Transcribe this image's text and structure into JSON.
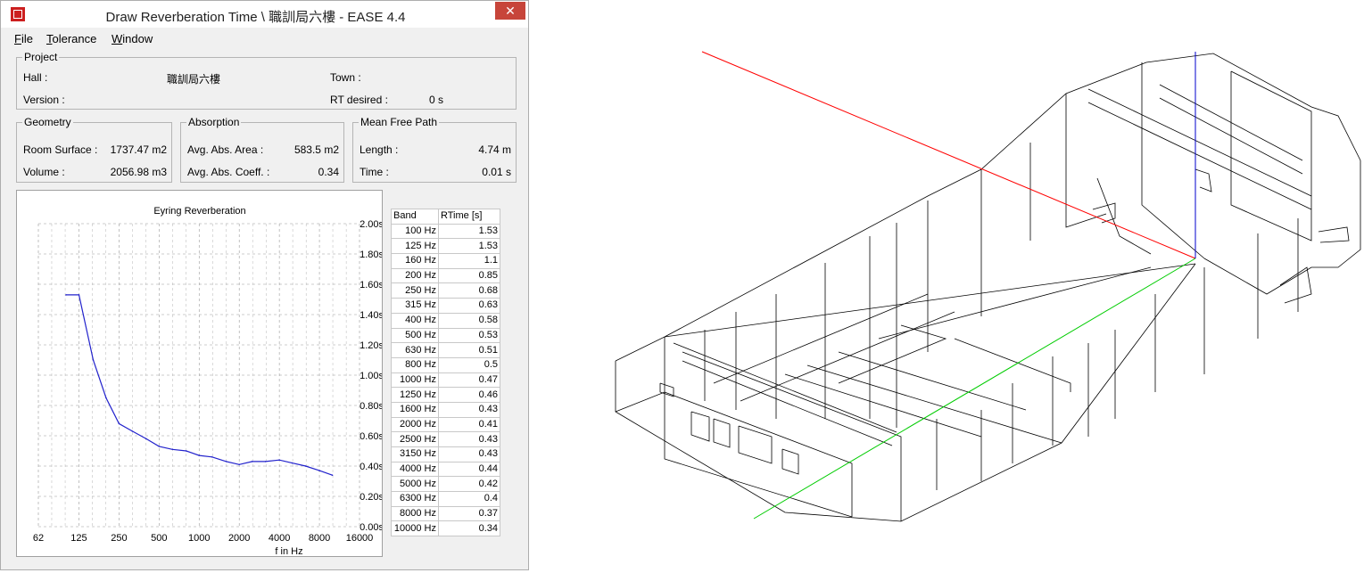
{
  "window": {
    "title": "Draw Reverberation Time \\ 職訓局六樓 - EASE 4.4",
    "close_glyph": "✕"
  },
  "menu": {
    "file": {
      "u": "F",
      "rest": "ile"
    },
    "tolerance": {
      "u": "T",
      "rest": "olerance"
    },
    "window": {
      "u": "W",
      "rest": "indow"
    }
  },
  "project": {
    "legend": "Project",
    "hall_label": "Hall :",
    "hall_value": "職訓局六樓",
    "version_label": "Version :",
    "town_label": "Town :",
    "rt_label": "RT desired :",
    "rt_value": "0 s"
  },
  "geometry": {
    "legend": "Geometry",
    "surface_label": "Room Surface :",
    "surface_value": "1737.47 m2",
    "volume_label": "Volume :",
    "volume_value": "2056.98 m3"
  },
  "absorption": {
    "legend": "Absorption",
    "area_label": "Avg. Abs. Area :",
    "area_value": "583.5 m2",
    "coeff_label": "Avg. Abs. Coeff. :",
    "coeff_value": "0.34"
  },
  "mfp": {
    "legend": "Mean Free Path",
    "length_label": "Length :",
    "length_value": "4.74 m",
    "time_label": "Time :",
    "time_value": "0.01 s"
  },
  "table": {
    "header_band": "Band",
    "header_rt": "RTime [s]"
  },
  "colors": {
    "curve": "#2222cc",
    "axis_x": "#ff0000",
    "axis_y": "#00cc00",
    "axis_z": "#0000cc"
  },
  "chart_data": {
    "type": "line",
    "title": "Eyring Reverberation",
    "xlabel": "f in Hz",
    "ylabel": "",
    "x_scale": "log",
    "x_tick_labels": [
      "62",
      "125",
      "250",
      "500",
      "1000",
      "2000",
      "4000",
      "8000",
      "16000"
    ],
    "x_ticks": [
      62,
      125,
      250,
      500,
      1000,
      2000,
      4000,
      8000,
      16000
    ],
    "y_tick_labels": [
      "0.00s",
      "0.20s",
      "0.40s",
      "0.60s",
      "0.80s",
      "1.00s",
      "1.20s",
      "1.40s",
      "1.60s",
      "1.80s",
      "2.00s"
    ],
    "ylim": [
      0,
      2.0
    ],
    "xlim": [
      62,
      16000
    ],
    "grid": true,
    "series": [
      {
        "x": [
          100,
          125,
          160,
          200,
          250,
          315,
          400,
          500,
          630,
          800,
          1000,
          1250,
          1600,
          2000,
          2500,
          3150,
          4000,
          5000,
          6300,
          8000,
          10000
        ],
        "bands": [
          "100 Hz",
          "125 Hz",
          "160 Hz",
          "200 Hz",
          "250 Hz",
          "315 Hz",
          "400 Hz",
          "500 Hz",
          "630 Hz",
          "800 Hz",
          "1000 Hz",
          "1250 Hz",
          "1600 Hz",
          "2000 Hz",
          "2500 Hz",
          "3150 Hz",
          "4000 Hz",
          "5000 Hz",
          "6300 Hz",
          "8000 Hz",
          "10000 Hz"
        ],
        "values": [
          1.53,
          1.53,
          1.1,
          0.85,
          0.68,
          0.63,
          0.58,
          0.53,
          0.51,
          0.5,
          0.47,
          0.46,
          0.43,
          0.41,
          0.43,
          0.43,
          0.44,
          0.42,
          0.4,
          0.37,
          0.34
        ]
      }
    ]
  }
}
